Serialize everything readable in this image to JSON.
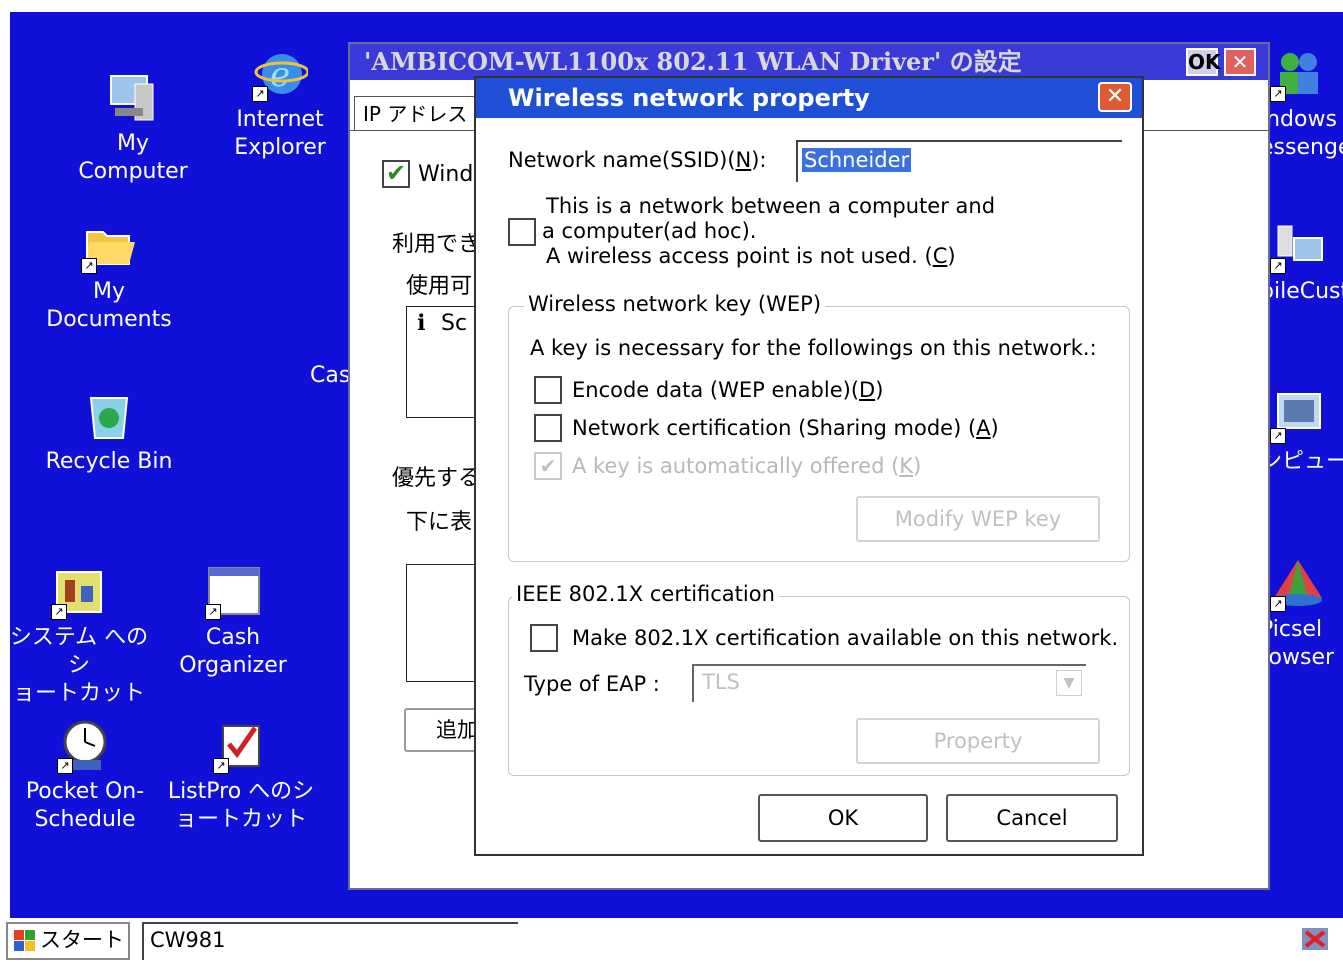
{
  "desktop": {
    "icons_left": [
      {
        "label": "My\nComputer"
      },
      {
        "label": "Internet\nExplorer"
      },
      {
        "label": "My\nDocuments"
      },
      {
        "label": "Recycle Bin"
      },
      {
        "label": "システム へのシ\nョートカット"
      },
      {
        "label": "Cash\nOrganizer"
      },
      {
        "label": "Pocket On-\nSchedule"
      },
      {
        "label": "ListPro へのシ\nョートカット"
      }
    ],
    "icons_right": [
      {
        "label": "indows\nessenge"
      },
      {
        "label": "bileCust"
      },
      {
        "label": "ンピュー"
      },
      {
        "label": "Picsel\nrowser"
      }
    ],
    "partial_label": "Cas"
  },
  "bg_window": {
    "title": "'AMBICOM-WL1100x 802.11 WLAN Driver' の設定",
    "ok": "OK",
    "close": "✕",
    "tab": "IP アドレス",
    "check_label": "Wind",
    "t1": "利用でき",
    "t2": "使用可",
    "item": "Sc",
    "t3": "優先する",
    "t4": "下に表",
    "add_button": "追加"
  },
  "dialog": {
    "title": "Wireless network property",
    "close": "✕",
    "ssid_label_pre": "Network name(SSID)(",
    "ssid_key": "N",
    "ssid_label_post": "):",
    "ssid_value": "Schneider",
    "adhoc_line1": "This is a network between a computer and",
    "adhoc_line2": "a computer(ad hoc).",
    "adhoc_line3_pre": "A wireless access point is not used. (",
    "adhoc_key": "C",
    "adhoc_line3_post": ")",
    "wep_group": "Wireless network key (WEP)",
    "wep_desc": "A key is necessary for the followings on this network.:",
    "encode_pre": "Encode data (WEP enable)(",
    "encode_key": "D",
    "encode_post": ")",
    "netcert_pre": "Network certification (Sharing mode) (",
    "netcert_key": "A",
    "netcert_post": ")",
    "autokey_pre": "A key is automatically offered (",
    "autokey_key": "K",
    "autokey_post": ")",
    "modify_button": "Modify WEP key",
    "ieee_group": "IEEE 802.1X certification",
    "ieee_check": "Make 802.1X certification available on this network.",
    "eap_label": "Type of EAP :",
    "eap_value": "TLS",
    "property_button": "Property",
    "ok_button": "OK",
    "cancel_button": "Cancel"
  },
  "taskbar": {
    "start": "スタート",
    "task": "CW981"
  }
}
